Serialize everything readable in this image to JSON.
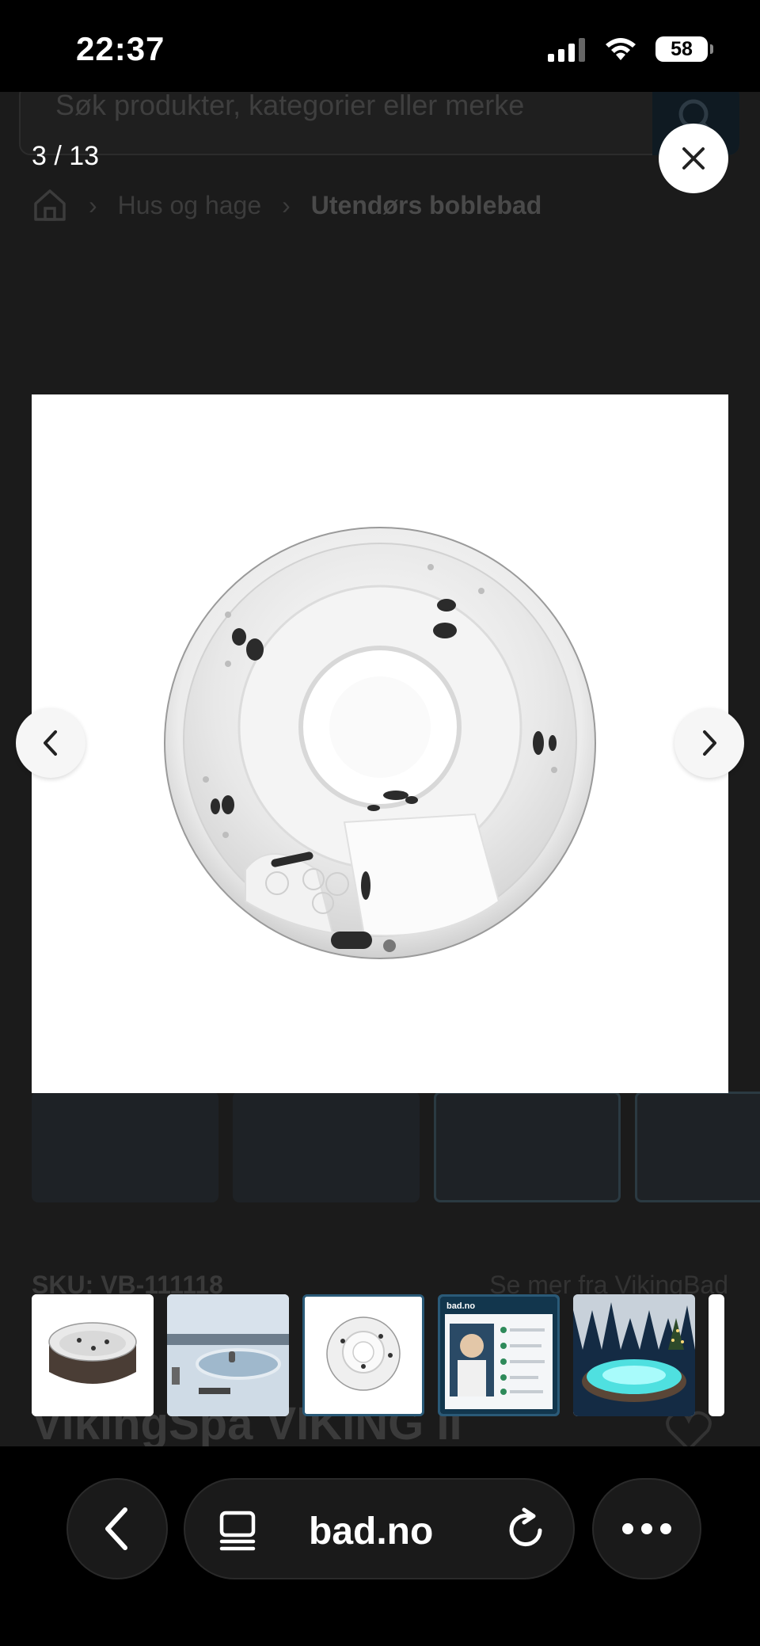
{
  "status_bar": {
    "time": "22:37",
    "battery": "58",
    "icons": [
      "signal-icon",
      "wifi-icon",
      "battery-icon"
    ]
  },
  "background_page": {
    "search_placeholder": "Søk produkter, kategorier eller merke",
    "breadcrumb": {
      "parent": "Hus og hage",
      "current": "Utendørs boblebad"
    },
    "sku": "SKU: VB-111118",
    "see_more": "Se mer fra VikingBad",
    "product_title": "VikingSpa VIKING II"
  },
  "gallery": {
    "counter": "3 / 13",
    "current_index": 3,
    "total": 13,
    "thumbnails": [
      {
        "name": "hot-tub-brown-cabinet",
        "active": false
      },
      {
        "name": "hot-tub-winter-lake",
        "active": false
      },
      {
        "name": "hot-tub-shell-top-view",
        "active": true
      },
      {
        "name": "bad-no-promo",
        "active": true
      },
      {
        "name": "hot-tub-lit-night",
        "active": false
      },
      {
        "name": "partial-thumb",
        "active": false
      }
    ],
    "promo_brand": "bad.no"
  },
  "browser": {
    "url": "bad.no"
  },
  "colors": {
    "overlay": "#1b1b1b",
    "active_thumb_border": "#2a5a78"
  }
}
